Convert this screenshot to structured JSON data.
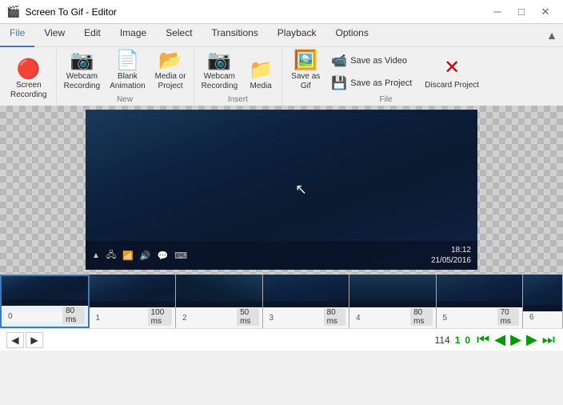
{
  "titleBar": {
    "icon": "🎬",
    "text": "Screen To Gif - Editor",
    "minLabel": "─",
    "maxLabel": "□",
    "closeLabel": "✕"
  },
  "menuBar": {
    "items": [
      "File",
      "View",
      "Edit",
      "Image",
      "Select",
      "Transitions",
      "Playback",
      "Options"
    ]
  },
  "ribbon": {
    "activeTab": "File",
    "newGroup": {
      "label": "New",
      "buttons": [
        {
          "id": "webcam-recording",
          "icon": "🎥",
          "label": "Webcam\nRecording"
        },
        {
          "id": "blank-animation",
          "icon": "📄",
          "label": "Blank\nAnimation"
        },
        {
          "id": "media-or-project",
          "icon": "📂",
          "label": "Media or\nProject"
        }
      ]
    },
    "insertGroup": {
      "label": "Insert",
      "buttons": [
        {
          "id": "webcam-recording-insert",
          "icon": "🎥",
          "label": "Webcam\nRecording"
        },
        {
          "id": "media-insert",
          "icon": "📁",
          "label": "Media"
        }
      ]
    },
    "fileGroup": {
      "label": "File",
      "saveAsGifLabel": "Save as\nGif",
      "saveAsVideoLabel": "Save as Video",
      "saveAsProjectLabel": "Save as Project",
      "discardLabel": "Discard\nProject"
    }
  },
  "timeline": {
    "frames": [
      {
        "index": "0",
        "delay": "80 ms",
        "selected": true
      },
      {
        "index": "1",
        "delay": "100 ms",
        "selected": false
      },
      {
        "index": "2",
        "delay": "50 ms",
        "selected": false
      },
      {
        "index": "3",
        "delay": "80 ms",
        "selected": false
      },
      {
        "index": "4",
        "delay": "80 ms",
        "selected": false
      },
      {
        "index": "5",
        "delay": "70 ms",
        "selected": false
      },
      {
        "index": "6",
        "delay": "",
        "selected": false
      }
    ]
  },
  "nav": {
    "prevPageLabel": "◀",
    "nextPageLabel": "▶",
    "frameCount": "114",
    "currentFrame": "1",
    "zoomLevel": "0",
    "firstLabel": "⏮",
    "prevLabel": "◀",
    "playLabel": "▶",
    "nextLabel": "▶",
    "lastLabel": "⏭",
    "arrows": {
      "first": "⏮",
      "prev": "◀",
      "play": "▶",
      "next": "▶",
      "last": "⏭"
    },
    "info": "114 1 0"
  },
  "preview": {
    "taskbarTime": "18:12",
    "taskbarDate": "21/05/2016"
  }
}
